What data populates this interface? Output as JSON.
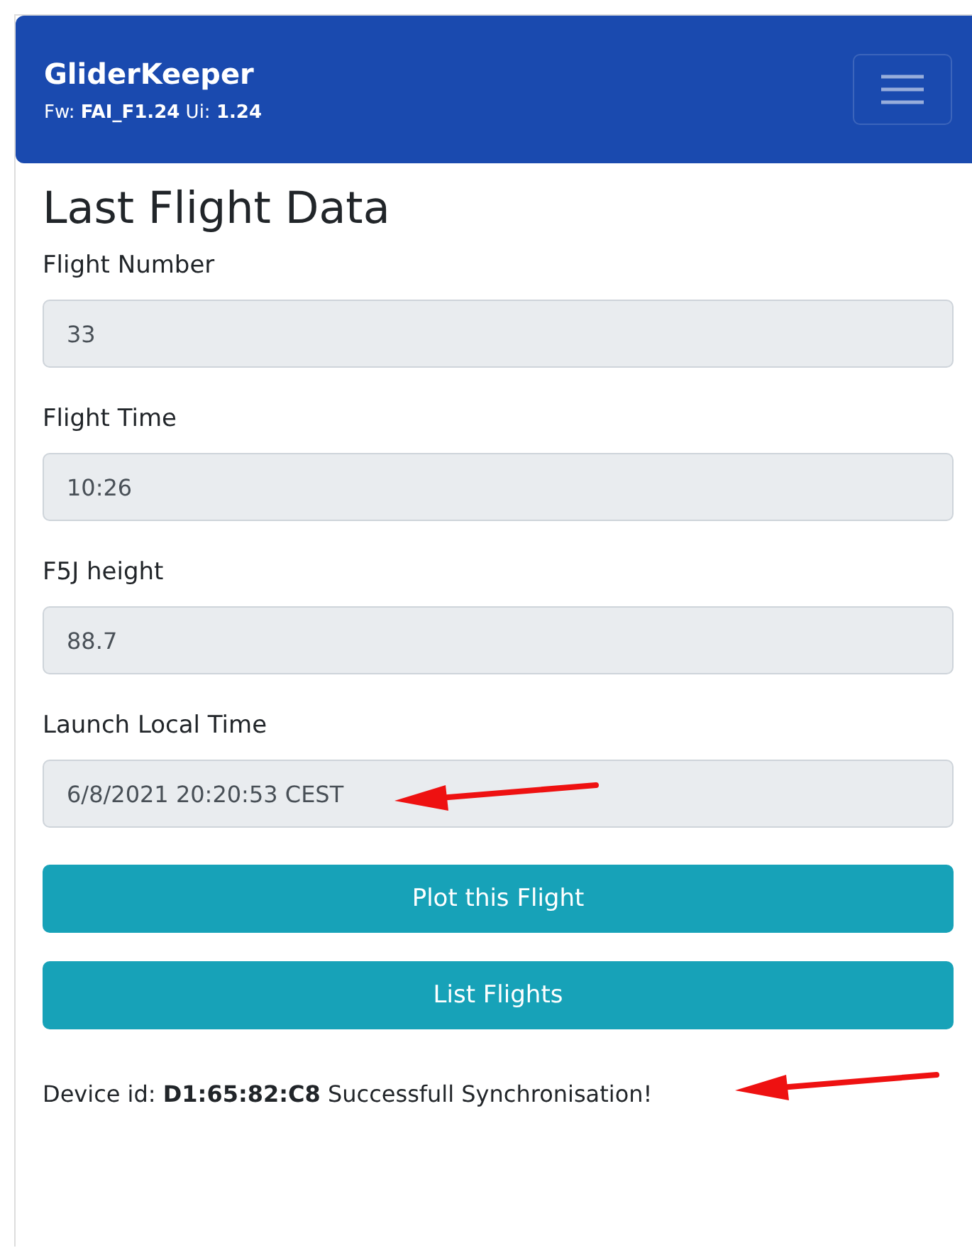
{
  "navbar": {
    "brand": "GliderKeeper",
    "version": "Fw: **FAI_F1.24** Ui: **1.24**"
  },
  "heading": "Last Flight Data",
  "fields": [
    {
      "label": "Flight Number",
      "value": "33",
      "arrow": false
    },
    {
      "label": "Flight Time",
      "value": "10:26",
      "arrow": false
    },
    {
      "label": "F5J height",
      "value": "88.7",
      "arrow": false
    },
    {
      "label": "Launch Local Time",
      "value": "6/8/2021 20:20:53 CEST",
      "arrow": true
    }
  ],
  "buttons": [
    "Plot this Flight",
    "List Flights"
  ],
  "status": {
    "text": "Device id: **D1:65:82:C8** Successfull Synchronisation!",
    "arrow": true
  }
}
